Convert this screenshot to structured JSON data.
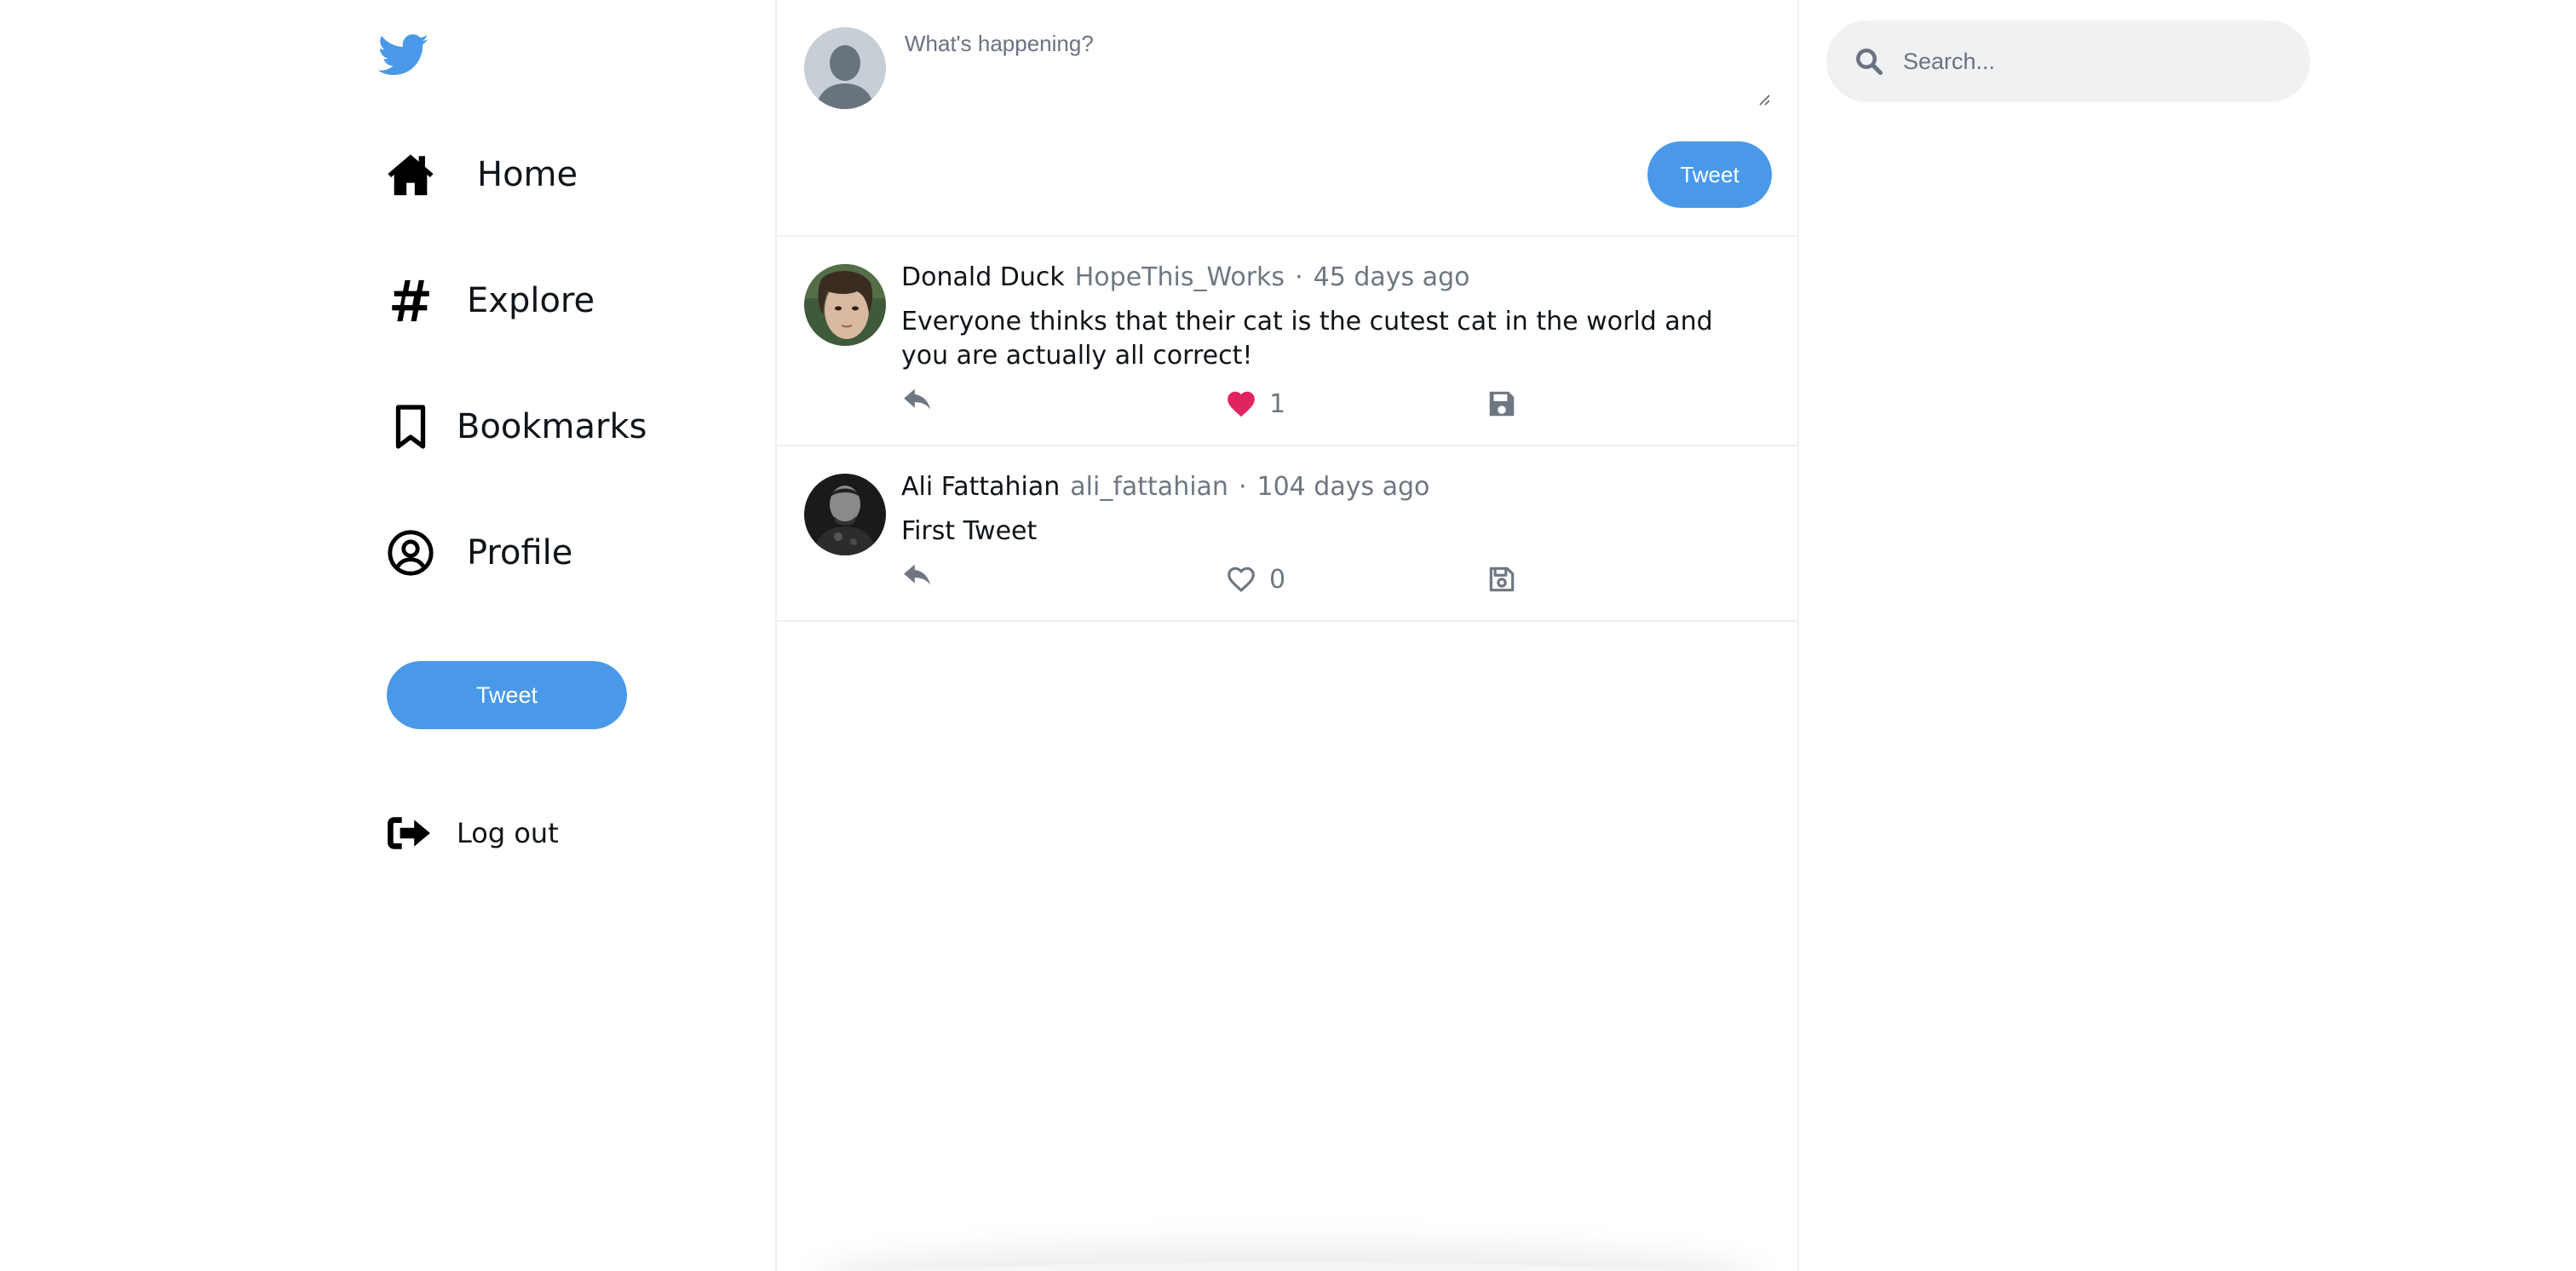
{
  "sidebar": {
    "logo_icon": "twitter-bird-icon",
    "brand_color": "#4a99e9",
    "nav": [
      {
        "label": "Home",
        "icon": "home-icon"
      },
      {
        "label": "Explore",
        "icon": "hashtag-icon"
      },
      {
        "label": "Bookmarks",
        "icon": "bookmark-icon"
      },
      {
        "label": "Profile",
        "icon": "user-circle-icon"
      }
    ],
    "tweet_button": "Tweet",
    "logout_label": "Log out",
    "logout_icon": "sign-out-icon"
  },
  "compose": {
    "placeholder": "What's happening?",
    "value": "",
    "tweet_button": "Tweet"
  },
  "tweets": [
    {
      "author": "Donald Duck",
      "handle": "HopeThis_Works",
      "separator": "·",
      "time": "45 days ago",
      "text": "Everyone thinks that their cat is the cutest cat in the world and you are actually all correct!",
      "likes": "1",
      "liked": true
    },
    {
      "author": "Ali Fattahian",
      "handle": "ali_fattahian",
      "separator": "·",
      "time": "104 days ago",
      "text": "First Tweet",
      "likes": "0",
      "liked": false
    }
  ],
  "search": {
    "placeholder": "Search...",
    "value": ""
  },
  "colors": {
    "accent": "#4a99e9",
    "like_active": "#e0245e",
    "muted_text": "#6e7781",
    "divider": "#eff1f3"
  }
}
